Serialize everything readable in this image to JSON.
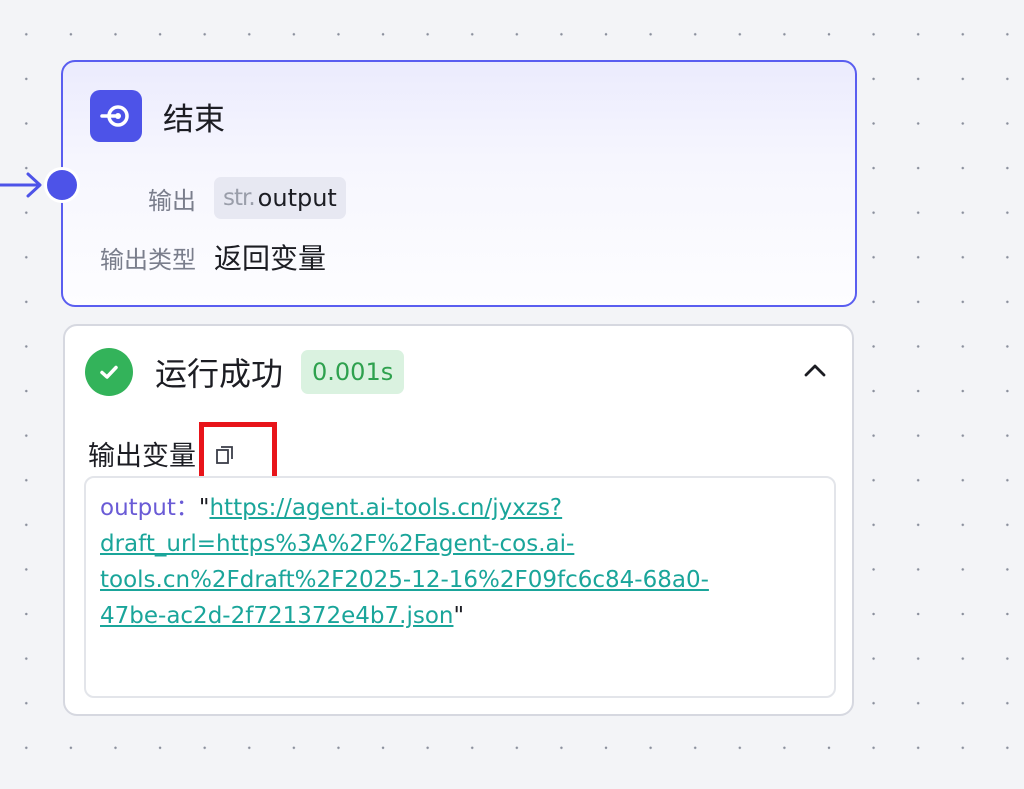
{
  "node": {
    "title": "结束",
    "icon": "end-node-icon",
    "output_label": "输出",
    "output_type": "str.",
    "output_name": "output",
    "output_type_label": "输出类型",
    "output_type_value": "返回变量"
  },
  "result": {
    "status": "运行成功",
    "duration": "0.001s",
    "variables_title": "输出变量",
    "output_key": "output",
    "separator": "：",
    "quote_open": "\"",
    "quote_close": "\"",
    "link_lines": [
      "https://agent.ai-tools.cn/jyxzs?",
      "draft_url=https%3A%2F%2Fagent-cos.ai-",
      "tools.cn%2Fdraft%2F2025-12-16%2F09fc6c84-68a0-",
      "47be-ac2d-2f721372e4b7.json"
    ]
  },
  "colors": {
    "accent": "#4d53e8",
    "success": "#33b35a",
    "link": "#1aa59a",
    "highlight_box": "#e8141a"
  }
}
